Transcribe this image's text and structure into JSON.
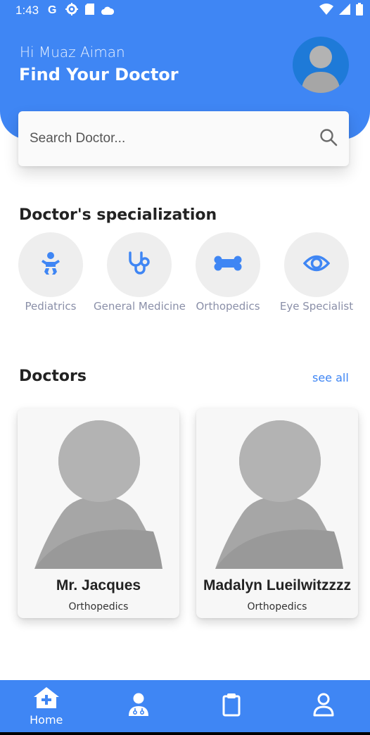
{
  "status_bar": {
    "time": "1:43",
    "icons": [
      "google-icon",
      "settings-icon",
      "sim-icon",
      "cloud-icon",
      "wifi-icon",
      "signal-icon",
      "battery-icon"
    ]
  },
  "header": {
    "greeting": "Hi Muaz Aiman",
    "title": "Find Your Doctor"
  },
  "search": {
    "placeholder": "Search Doctor..."
  },
  "specialization": {
    "title": "Doctor's specialization",
    "items": [
      {
        "label": "Pediatrics",
        "icon": "baby-icon"
      },
      {
        "label": "General Medicine",
        "icon": "stethoscope-icon"
      },
      {
        "label": "Orthopedics",
        "icon": "bone-icon"
      },
      {
        "label": "Eye Specialist",
        "icon": "eye-icon"
      }
    ]
  },
  "doctors": {
    "title": "Doctors",
    "see_all": "see all",
    "list": [
      {
        "name": "Mr. Jacques",
        "specialty": "Orthopedics"
      },
      {
        "name": "Madalyn Lueilwitzzzz",
        "specialty": "Orthopedics"
      }
    ]
  },
  "bottom_nav": {
    "items": [
      {
        "label": "Home",
        "icon": "home-icon"
      },
      {
        "label": "",
        "icon": "doctor-icon"
      },
      {
        "label": "",
        "icon": "clipboard-icon"
      },
      {
        "label": "",
        "icon": "profile-icon"
      }
    ]
  },
  "colors": {
    "primary": "#3f86f4",
    "avatar_bg": "#1e7ad8",
    "circle_bg": "#eeeeee",
    "label_gray": "#8a8fa8"
  }
}
